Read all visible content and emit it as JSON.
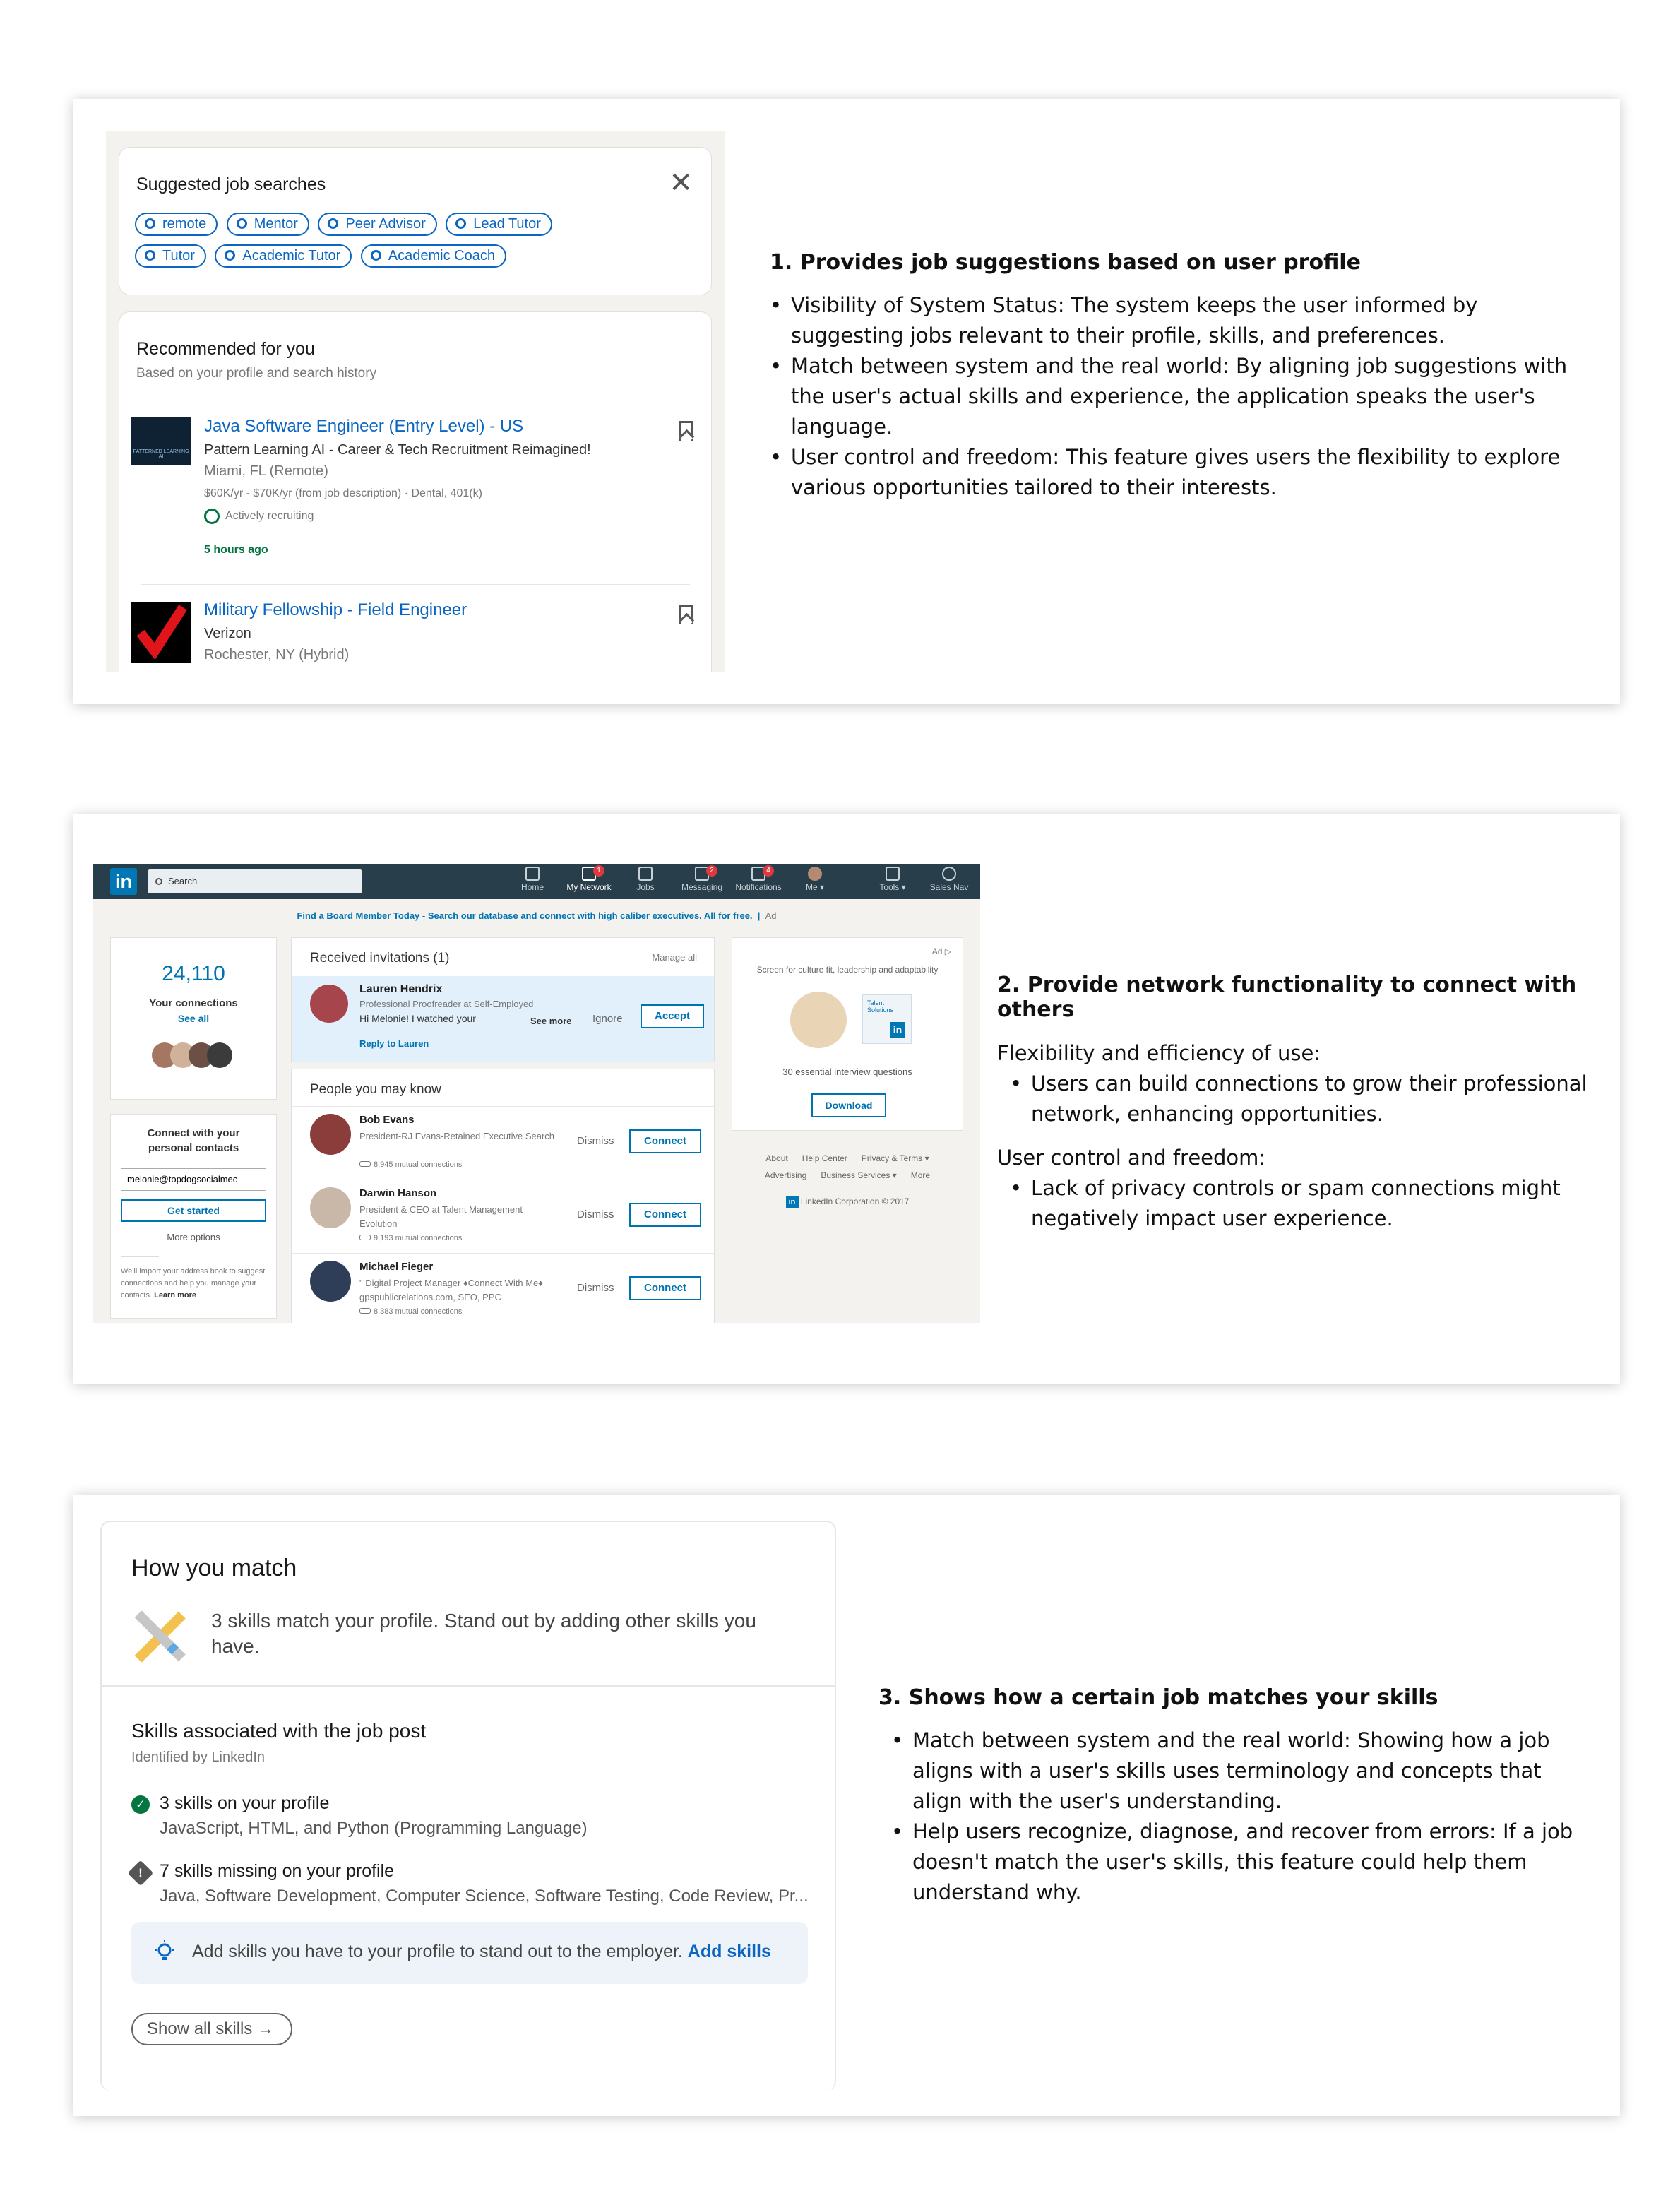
{
  "section1": {
    "panel": {
      "suggested_title": "Suggested job searches",
      "chips": [
        "remote",
        "Mentor",
        "Peer Advisor",
        "Lead Tutor",
        "Tutor",
        "Academic Tutor",
        "Academic Coach"
      ],
      "recommended_title": "Recommended for you",
      "recommended_sub": "Based on your profile and search history",
      "jobs": [
        {
          "title": "Java Software Engineer (Entry Level) - US",
          "company": "Pattern Learning AI - Career & Tech Recruitment Reimagined!",
          "location": "Miami, FL (Remote)",
          "salary": "$60K/yr - $70K/yr (from job description) · Dental, 401(k)",
          "status": "Actively recruiting",
          "posted": "5 hours ago",
          "logo_text": "PATTERNED LEARNING AI"
        },
        {
          "title": "Military Fellowship - Field Engineer",
          "company": "Verizon",
          "location": "Rochester, NY (Hybrid)"
        }
      ]
    },
    "notes": {
      "heading": "1. Provides job suggestions based on user profile",
      "bullets": [
        "Visibility of System Status: The system keeps the user informed by suggesting jobs relevant to their profile, skills, and preferences.",
        "Match between system and the real world: By aligning job suggestions with the user's actual skills and experience, the application speaks the user's language.",
        "User control and freedom: This feature gives users the flexibility to explore various opportunities tailored to their interests."
      ]
    }
  },
  "section2": {
    "panel": {
      "nav": {
        "logo": "in",
        "search_placeholder": "Search",
        "items": [
          "Home",
          "My Network",
          "Jobs",
          "Messaging",
          "Notifications",
          "Me ▾",
          "Tools ▾",
          "Sales Nav"
        ],
        "badges": {
          "my_network": "1",
          "messaging": "2",
          "notifications": "4"
        }
      },
      "ad_line": "Find a Board Member Today - Search our database and connect with high caliber executives. All for free.",
      "ad_tag": "Ad",
      "connections_count": "24,110",
      "connections_label": "Your connections",
      "see_all": "See all",
      "contacts": {
        "title": "Connect with your personal contacts",
        "email": "melonie@topdogsocialmec",
        "button": "Get started",
        "more": "More options",
        "note": "We'll import your address book to suggest connections and help you manage your contacts.",
        "learn_more": "Learn more"
      },
      "invitations": {
        "title": "Received invitations (1)",
        "manage": "Manage all",
        "name": "Lauren Hendrix",
        "headline": "Professional Proofreader at Self-Employed",
        "message": "Hi Melonie! I watched your",
        "see_more": "See more",
        "ignore": "Ignore",
        "accept": "Accept",
        "reply": "Reply to Lauren"
      },
      "pymk": {
        "title": "People you may know",
        "dismiss": "Dismiss",
        "connect": "Connect",
        "people": [
          {
            "name": "Bob Evans",
            "headline": "President-RJ Evans-Retained Executive Search",
            "mutual": "8,945 mutual connections"
          },
          {
            "name": "Darwin Hanson",
            "headline": "President & CEO at Talent Management Evolution",
            "mutual": "9,193 mutual connections"
          },
          {
            "name": "Michael Fieger",
            "headline": "\" Digital Project Manager ♦Connect With Me♦ gpspublicrelations.com, SEO, PPC",
            "mutual": "8,383 mutual connections"
          }
        ]
      },
      "ad_card": {
        "ad": "Ad ▷",
        "text": "Screen for culture fit, leadership and adaptability",
        "brand": "Talent Solutions",
        "caption": "30 essential interview questions",
        "button": "Download"
      },
      "footer": {
        "links_row1": [
          "About",
          "Help Center",
          "Privacy & Terms ▾"
        ],
        "links_row2": [
          "Advertising",
          "Business Services ▾",
          "More"
        ],
        "corp": "LinkedIn Corporation © 2017"
      }
    },
    "notes": {
      "heading": "2. Provide network functionality to connect with others",
      "group1_title": "Flexibility and efficiency of use:",
      "group1_bullets": [
        "Users can build connections to grow their professional network, enhancing opportunities."
      ],
      "group2_title": "User control and freedom:",
      "group2_bullets": [
        "Lack of privacy controls or spam connections might negatively impact user experience."
      ]
    }
  },
  "section3": {
    "panel": {
      "title": "How you match",
      "summary": "3 skills match your profile. Stand out by adding other skills you have.",
      "skills_title": "Skills associated with the job post",
      "skills_sub": "Identified by LinkedIn",
      "on_profile_title": "3 skills on your profile",
      "on_profile_list": "JavaScript, HTML, and Python (Programming Language)",
      "missing_title": "7 skills missing on your profile",
      "missing_list": "Java, Software Development, Computer Science, Software Testing, Code Review, Pr...",
      "tip_text": "Add skills you have to your profile to stand out to the employer.",
      "tip_link": "Add skills",
      "show_all": "Show all skills"
    },
    "notes": {
      "heading": "3. Shows how a certain job matches your skills",
      "bullets": [
        "Match between system and the real world: Showing how a job aligns with a user's skills uses terminology and concepts that align with the user's understanding.",
        "Help users recognize, diagnose, and recover from errors: If a job doesn't match the user's skills, this feature could help them understand why."
      ]
    }
  },
  "colors": {
    "linkedin_blue": "#0a66c2",
    "nav_dark": "#283e4a",
    "success_green": "#057642",
    "page_bg": "#f3f2ef"
  }
}
